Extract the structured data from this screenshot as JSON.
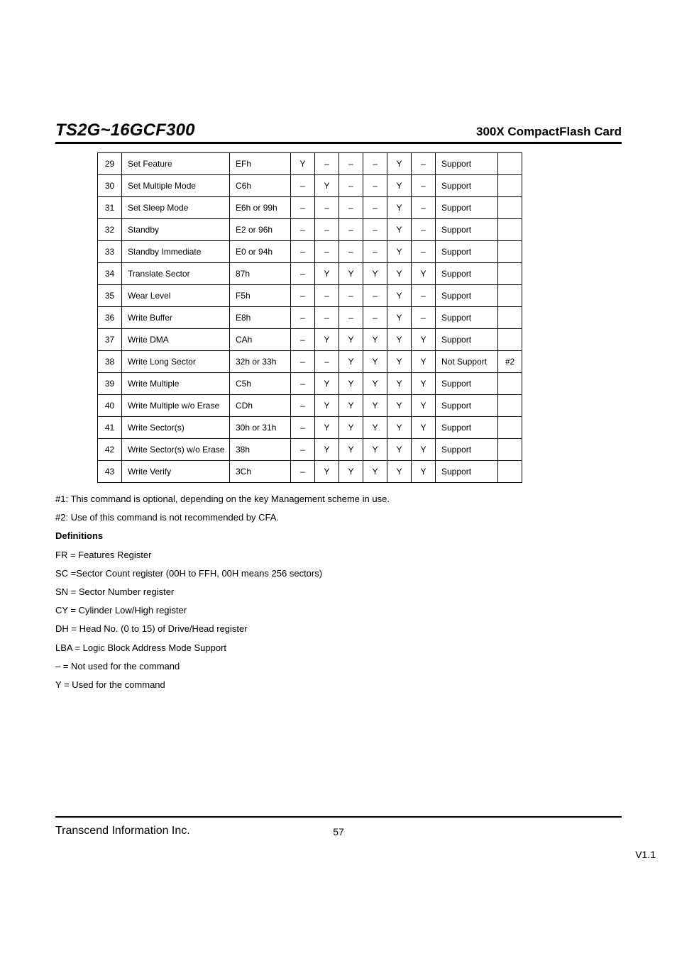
{
  "header": {
    "model": "TS2G~16GCF300",
    "product": "300X CompactFlash Card"
  },
  "table": {
    "rows": [
      {
        "num": "29",
        "name": "Set Feature",
        "code": "EFh",
        "fr": "Y",
        "sc": "–",
        "sn": "–",
        "cy": "–",
        "dh": "Y",
        "lba": "–",
        "support": "Support",
        "note": ""
      },
      {
        "num": "30",
        "name": "Set Multiple Mode",
        "code": "C6h",
        "fr": "–",
        "sc": "Y",
        "sn": "–",
        "cy": "–",
        "dh": "Y",
        "lba": "–",
        "support": "Support",
        "note": ""
      },
      {
        "num": "31",
        "name": "Set Sleep Mode",
        "code": "E6h or 99h",
        "fr": "–",
        "sc": "–",
        "sn": "–",
        "cy": "–",
        "dh": "Y",
        "lba": "–",
        "support": "Support",
        "note": ""
      },
      {
        "num": "32",
        "name": "Standby",
        "code": "E2 or 96h",
        "fr": "–",
        "sc": "–",
        "sn": "–",
        "cy": "–",
        "dh": "Y",
        "lba": "–",
        "support": "Support",
        "note": ""
      },
      {
        "num": "33",
        "name": "Standby Immediate",
        "code": "E0 or 94h",
        "fr": "–",
        "sc": "–",
        "sn": "–",
        "cy": "–",
        "dh": "Y",
        "lba": "–",
        "support": "Support",
        "note": ""
      },
      {
        "num": "34",
        "name": "Translate Sector",
        "code": "87h",
        "fr": "–",
        "sc": "Y",
        "sn": "Y",
        "cy": "Y",
        "dh": "Y",
        "lba": "Y",
        "support": "Support",
        "note": ""
      },
      {
        "num": "35",
        "name": "Wear Level",
        "code": "F5h",
        "fr": "–",
        "sc": "–",
        "sn": "–",
        "cy": "–",
        "dh": "Y",
        "lba": "–",
        "support": "Support",
        "note": ""
      },
      {
        "num": "36",
        "name": "Write Buffer",
        "code": "E8h",
        "fr": "–",
        "sc": "–",
        "sn": "–",
        "cy": "–",
        "dh": "Y",
        "lba": "–",
        "support": "Support",
        "note": ""
      },
      {
        "num": "37",
        "name": "Write DMA",
        "code": "CAh",
        "fr": "–",
        "sc": "Y",
        "sn": "Y",
        "cy": "Y",
        "dh": "Y",
        "lba": "Y",
        "support": "Support",
        "note": ""
      },
      {
        "num": "38",
        "name": "Write Long Sector",
        "code": "32h or 33h",
        "fr": "–",
        "sc": "–",
        "sn": "Y",
        "cy": "Y",
        "dh": "Y",
        "lba": "Y",
        "support": "Not Support",
        "note": "#2"
      },
      {
        "num": "39",
        "name": "Write Multiple",
        "code": "C5h",
        "fr": "–",
        "sc": "Y",
        "sn": "Y",
        "cy": "Y",
        "dh": "Y",
        "lba": "Y",
        "support": "Support",
        "note": ""
      },
      {
        "num": "40",
        "name": "Write Multiple w/o Erase",
        "code": "CDh",
        "fr": "–",
        "sc": "Y",
        "sn": "Y",
        "cy": "Y",
        "dh": "Y",
        "lba": "Y",
        "support": "Support",
        "note": ""
      },
      {
        "num": "41",
        "name": "Write Sector(s)",
        "code": "30h or 31h",
        "fr": "–",
        "sc": "Y",
        "sn": "Y",
        "cy": "Y",
        "dh": "Y",
        "lba": "Y",
        "support": "Support",
        "note": ""
      },
      {
        "num": "42",
        "name": "Write Sector(s) w/o Erase",
        "code": "38h",
        "fr": "–",
        "sc": "Y",
        "sn": "Y",
        "cy": "Y",
        "dh": "Y",
        "lba": "Y",
        "support": "Support",
        "note": ""
      },
      {
        "num": "43",
        "name": "Write Verify",
        "code": "3Ch",
        "fr": "–",
        "sc": "Y",
        "sn": "Y",
        "cy": "Y",
        "dh": "Y",
        "lba": "Y",
        "support": "Support",
        "note": ""
      }
    ]
  },
  "notes": {
    "n1": "#1: This command is optional, depending on the key Management scheme in use.",
    "n2": "#2: Use of this command is not recommended by CFA.",
    "defs_heading": "Definitions",
    "defs": [
      "FR = Features Register",
      "SC =Sector Count register (00H to FFH, 00H means 256 sectors)",
      "SN = Sector Number register",
      "CY = Cylinder Low/High register",
      "DH = Head No. (0 to 15) of Drive/Head register",
      "LBA = Logic Block Address Mode Support",
      "– = Not used for the command",
      "Y = Used for the command"
    ]
  },
  "footer": {
    "company": "Transcend Information Inc.",
    "page": "57",
    "version": "V1.1"
  }
}
